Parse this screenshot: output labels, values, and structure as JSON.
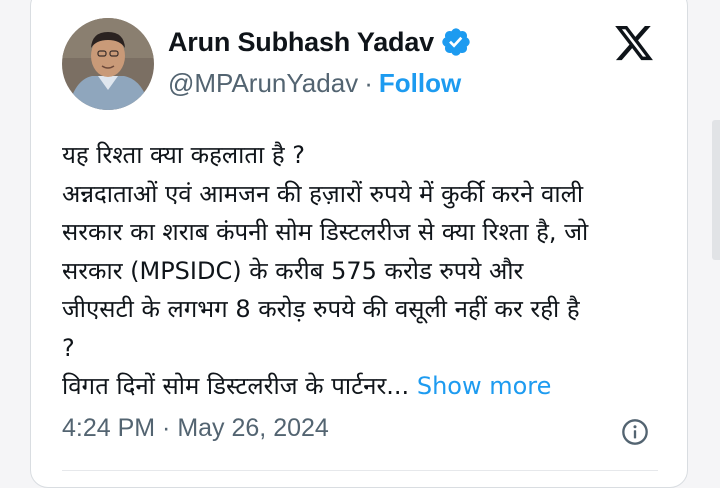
{
  "author": {
    "display_name": "Arun Subhash Yadav",
    "handle": "@MPArunYadav",
    "separator": "·",
    "follow_label": "Follow",
    "verified_color": "#1d9bf0"
  },
  "tweet": {
    "lines": [
      "यह रिश्ता क्या कहलाता है ?",
      "अन्नदाताओं एवं आमजन की हज़ारों रुपये में कुर्की करने वाली",
      "सरकार का शराब कंपनी सोम डिस्टलरीज से क्या रिश्ता है, जो",
      "सरकार (MPSIDC) के करीब 575 करोड रुपये और",
      "जीएसटी के लगभग 8 करोड़ रुपये की वसूली नहीं कर रही है",
      "?",
      "विगत दिनों सोम डिस्टलरीज के पार्टनर..."
    ],
    "show_more_label": "Show more",
    "timestamp": "4:24 PM · May 26, 2024"
  },
  "icons": {
    "platform": "x-logo-icon",
    "verified": "verified-badge-icon",
    "info": "info-icon"
  },
  "colors": {
    "link_blue": "#1d9bf0",
    "text_primary": "#0f1419",
    "text_secondary": "#536471"
  }
}
